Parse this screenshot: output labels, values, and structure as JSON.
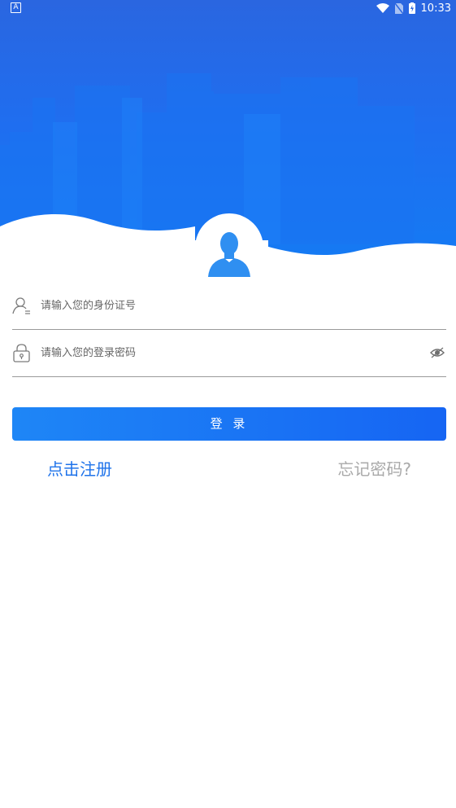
{
  "status_bar": {
    "notification_glyph": "A",
    "icons": [
      "wifi-icon",
      "no-sim-icon",
      "battery-charging-icon"
    ],
    "time": "10:33"
  },
  "form": {
    "id_placeholder": "请输入您的身份证号",
    "password_placeholder": "请输入您的登录密码"
  },
  "actions": {
    "login_label": "登 录",
    "register_label": "点击注册",
    "forgot_label": "忘记密码?"
  },
  "colors": {
    "primary": "#1f73ea",
    "header_gradient_top": "#2a66e0",
    "header_gradient_bottom": "#137cf4",
    "forgot_text": "#a9a9a9"
  }
}
